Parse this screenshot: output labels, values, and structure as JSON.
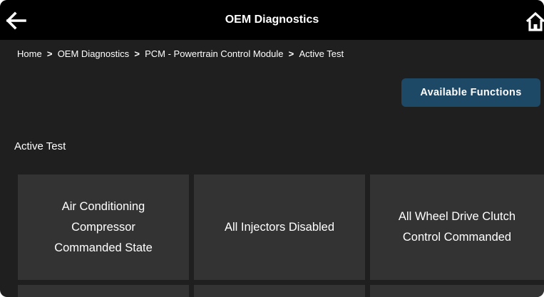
{
  "header": {
    "title": "OEM Diagnostics",
    "back_icon": "arrow-left-icon",
    "home_icon": "home-icon"
  },
  "breadcrumb": [
    "Home",
    "OEM Diagnostics",
    "PCM - Powertrain Control Module",
    "Active Test"
  ],
  "breadcrumb_separator": ">",
  "available_functions_label": "Available Functions",
  "section_title": "Active Test",
  "tests": [
    {
      "label": "Air Conditioning Compressor Commanded State"
    },
    {
      "label": "All Injectors Disabled"
    },
    {
      "label": "All Wheel Drive Clutch Control Commanded"
    },
    {
      "label": ""
    },
    {
      "label": ""
    },
    {
      "label": ""
    }
  ],
  "colors": {
    "background": "#1f1f1f",
    "header": "#000000",
    "tile": "#333333",
    "accent_button": "#1d4866",
    "text": "#ffffff"
  }
}
